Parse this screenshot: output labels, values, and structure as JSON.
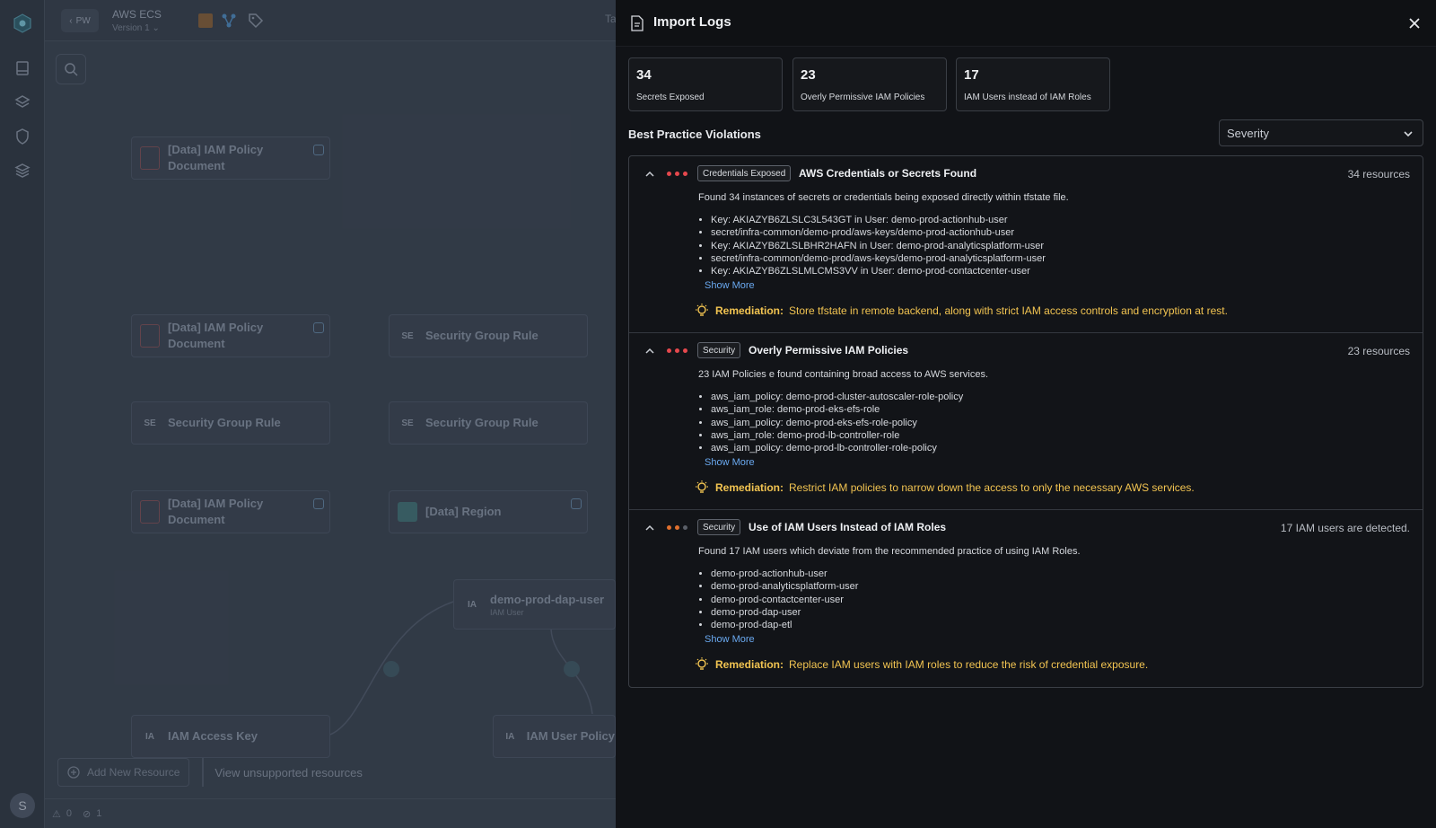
{
  "background": {
    "project": {
      "back_label": "PW",
      "title": "AWS ECS",
      "version": "Version 1",
      "tab_cut": "Ta"
    },
    "nodes": [
      {
        "abbr": "",
        "label": "[Data] IAM Policy Document",
        "kind": "doc"
      },
      {
        "abbr": "",
        "label": "[Data] IAM Policy Document",
        "kind": "doc"
      },
      {
        "abbr": "SE",
        "label": "Security Group Rule",
        "kind": "plain"
      },
      {
        "abbr": "SE",
        "label": "Security Group Rule",
        "kind": "plain"
      },
      {
        "abbr": "SE",
        "label": "Security Group Rule",
        "kind": "plain"
      },
      {
        "abbr": "",
        "label": "[Data] IAM Policy Document",
        "kind": "doc"
      },
      {
        "abbr": "",
        "label": "[Data] Region",
        "kind": "region"
      },
      {
        "abbr": "IA",
        "label": "demo-prod-dap-user",
        "sub": "IAM User",
        "kind": "plain"
      },
      {
        "abbr": "IA",
        "label": "IAM Access Key",
        "kind": "plain"
      },
      {
        "abbr": "IA",
        "label": "IAM User Policy",
        "kind": "plain"
      }
    ],
    "add_resource": "Add New Resource",
    "view_unsupported": "View unsupported resources",
    "status": {
      "warnings": "0",
      "errors": "1"
    },
    "avatar": "S"
  },
  "drawer": {
    "title": "Import Logs",
    "stats": [
      {
        "value": "34",
        "label": "Secrets Exposed"
      },
      {
        "value": "23",
        "label": "Overly Permissive IAM Policies"
      },
      {
        "value": "17",
        "label": "IAM Users instead of IAM Roles"
      }
    ],
    "section_title": "Best Practice Violations",
    "filter": {
      "selected": "Severity"
    },
    "violations": [
      {
        "tag": "Credentials Exposed",
        "title": "AWS Credentials or Secrets Found",
        "count": "34 resources",
        "severity_dots": [
          "#e5484d",
          "#e5484d",
          "#e5484d"
        ],
        "description": "Found 34 instances of secrets or credentials being exposed directly within tfstate file.",
        "items": [
          "Key: AKIAZYB6ZLSLC3L543GT in User: demo-prod-actionhub-user",
          "secret/infra-common/demo-prod/aws-keys/demo-prod-actionhub-user",
          "Key: AKIAZYB6ZLSLBHR2HAFN in User: demo-prod-analyticsplatform-user",
          "secret/infra-common/demo-prod/aws-keys/demo-prod-analyticsplatform-user",
          "Key: AKIAZYB6ZLSLMLCMS3VV in User: demo-prod-contactcenter-user"
        ],
        "show_more": "Show More",
        "remediation_label": "Remediation:",
        "remediation": "Store tfstate in remote backend, along with strict IAM access controls and encryption at rest."
      },
      {
        "tag": "Security",
        "title": "Overly Permissive IAM Policies",
        "count": "23 resources",
        "severity_dots": [
          "#e5484d",
          "#e5484d",
          "#e5484d"
        ],
        "description": "23 IAM Policies e found containing broad access to AWS services.",
        "items": [
          "aws_iam_policy: demo-prod-cluster-autoscaler-role-policy",
          "aws_iam_role: demo-prod-eks-efs-role",
          "aws_iam_policy: demo-prod-eks-efs-role-policy",
          "aws_iam_role: demo-prod-lb-controller-role",
          "aws_iam_policy: demo-prod-lb-controller-role-policy"
        ],
        "show_more": "Show More",
        "remediation_label": "Remediation:",
        "remediation": "Restrict IAM policies to narrow down the access to only the necessary AWS services."
      },
      {
        "tag": "Security",
        "title": "Use of IAM Users Instead of IAM Roles",
        "count": "17 IAM users are detected.",
        "severity_dots": [
          "#e0702e",
          "#e0702e",
          "#5a5f68"
        ],
        "description": "Found 17 IAM users which deviate from the recommended practice of using IAM Roles.",
        "items": [
          "demo-prod-actionhub-user",
          "demo-prod-analyticsplatform-user",
          "demo-prod-contactcenter-user",
          "demo-prod-dap-user",
          "demo-prod-dap-etl"
        ],
        "show_more": "Show More",
        "remediation_label": "Remediation:",
        "remediation": "Replace IAM users with IAM roles to reduce the risk of credential exposure."
      }
    ]
  }
}
